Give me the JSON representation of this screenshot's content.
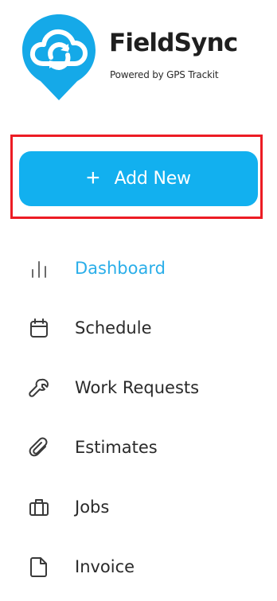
{
  "brand": {
    "name": "FieldSync",
    "tagline": "Powered by GPS Trackit"
  },
  "primary_action": {
    "icon": "plus-icon",
    "label": "Add New"
  },
  "navigation": {
    "active_item": "Dashboard",
    "items": [
      {
        "label": "Dashboard",
        "icon": "bar-chart-icon"
      },
      {
        "label": "Schedule",
        "icon": "calendar-icon"
      },
      {
        "label": "Work Requests",
        "icon": "wrench-icon"
      },
      {
        "label": "Estimates",
        "icon": "paperclip-icon"
      },
      {
        "label": "Jobs",
        "icon": "briefcase-icon"
      },
      {
        "label": "Invoice",
        "icon": "document-icon"
      }
    ]
  },
  "colors": {
    "accent": "#12b0ef",
    "active_text": "#2aaee9",
    "text": "#2a2a2a",
    "highlight_border": "#ec1c24"
  }
}
